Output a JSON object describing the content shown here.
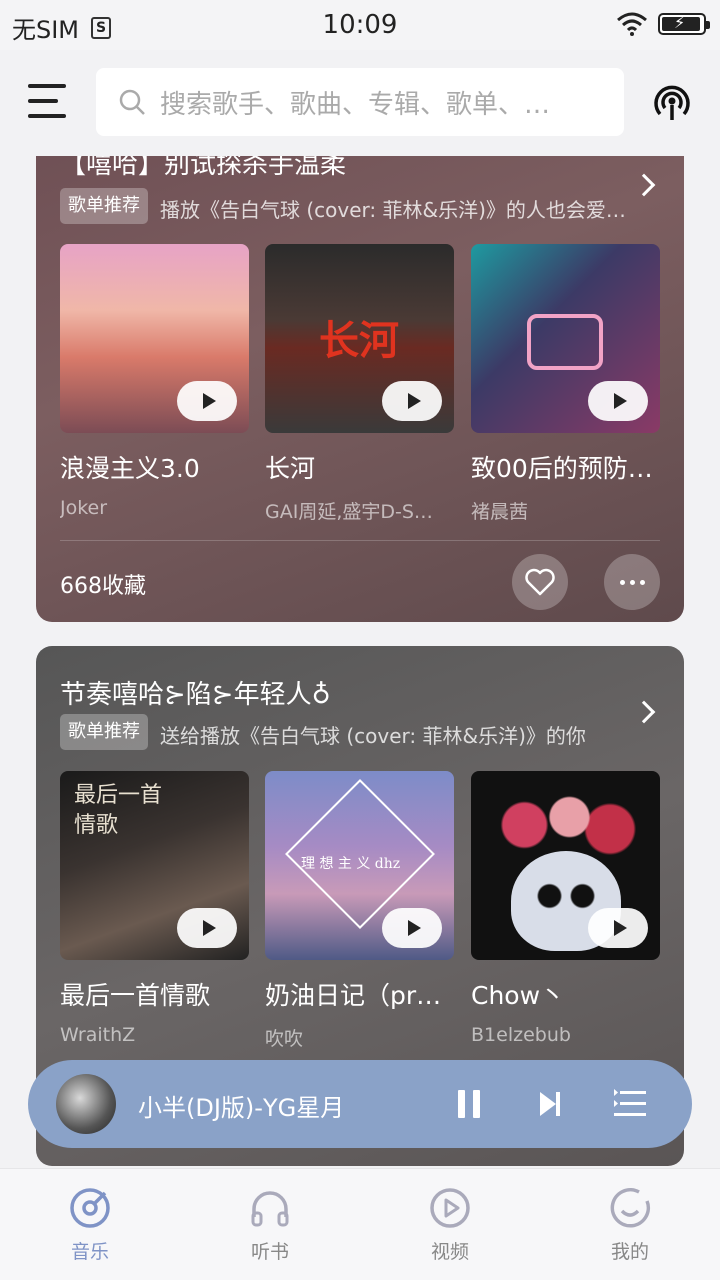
{
  "status_bar": {
    "carrier": "无SIM",
    "time": "10:09"
  },
  "search": {
    "placeholder": "搜索歌手、歌曲、专辑、歌单、…"
  },
  "cards": [
    {
      "title": "【嘻哈】别试探杀手温柔",
      "tag": "歌单推荐",
      "reason": "播放《告白气球 (cover: 菲林&乐洋)》的人也会爱…",
      "albums": [
        {
          "name": "浪漫主义3.0",
          "artist": "Joker"
        },
        {
          "name": "长河",
          "artist": "GAI周延,盛宇D-S…"
        },
        {
          "name": "致00后的预防…",
          "artist": "褚晨茜"
        }
      ],
      "collect": "668收藏"
    },
    {
      "title": "节奏嘻哈⊱陷⊱年轻人♁",
      "tag": "歌单推荐",
      "reason": "送给播放《告白气球 (cover: 菲林&乐洋)》的你",
      "albums": [
        {
          "name": "最后一首情歌",
          "artist": "WraithZ"
        },
        {
          "name": "奶油日记（pr…",
          "artist": "吹吹"
        },
        {
          "name": "Chow丶",
          "artist": "B1elzebub"
        }
      ]
    }
  ],
  "player": {
    "title": "小半(DJ版)-YG星月"
  },
  "tabs": [
    {
      "label": "音乐",
      "icon": "music-disc-icon"
    },
    {
      "label": "听书",
      "icon": "headphones-icon"
    },
    {
      "label": "视频",
      "icon": "video-play-icon"
    },
    {
      "label": "我的",
      "icon": "profile-icon"
    }
  ],
  "colors": {
    "accent": "#7f93c6",
    "player_bg": "#8aa2c8",
    "card1_bg": "#6e4f54",
    "card2_bg": "#5e5a5a"
  }
}
